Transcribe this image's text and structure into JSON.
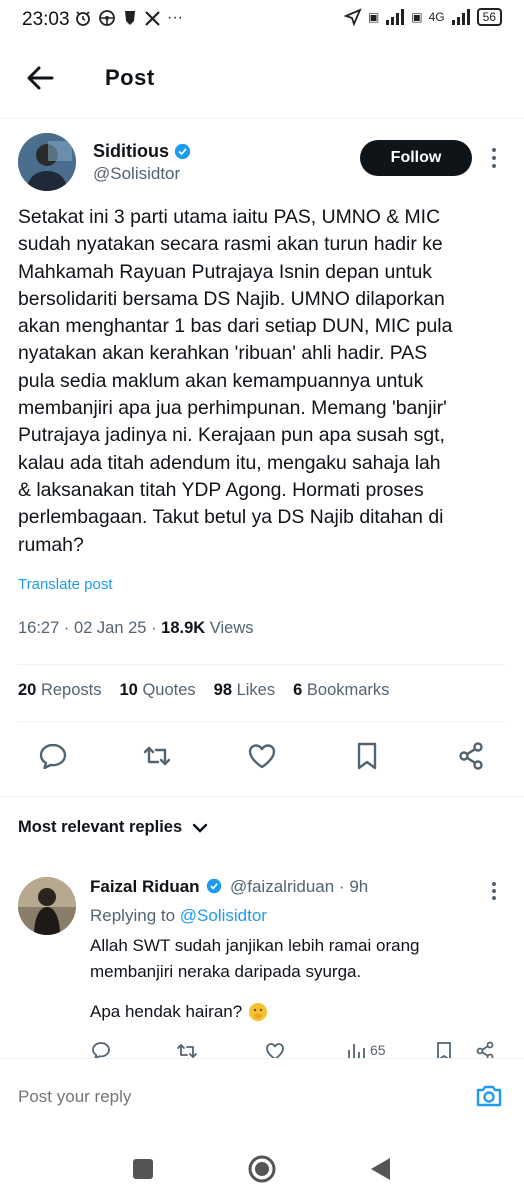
{
  "status_bar": {
    "time": "23:03",
    "network": "4G",
    "battery": "56"
  },
  "header": {
    "title": "Post"
  },
  "post": {
    "author_name": "Siditious",
    "author_handle": "@Solisidtor",
    "follow_label": "Follow",
    "text_lines": [
      "Setakat ini 3 parti utama iaitu PAS, UMNO & MIC",
      "sudah nyatakan secara rasmi akan turun hadir ke",
      "Mahkamah Rayuan Putrajaya Isnin depan untuk",
      "bersolidariti bersama DS Najib. UMNO dilaporkan",
      "akan menghantar 1 bas dari setiap DUN, MIC pula",
      "nyatakan akan kerahkan 'ribuan' ahli hadir. PAS",
      "pula sedia maklum akan kemampuannya untuk",
      "membanjiri apa jua perhimpunan. Memang 'banjir'",
      "Putrajaya jadinya ni. Kerajaan pun apa susah sgt,",
      "kalau ada titah adendum itu, mengaku sahaja lah",
      "& laksanakan titah YDP Agong. Hormati proses",
      "perlembagaan. Takut betul ya DS Najib ditahan di",
      "rumah?"
    ],
    "translate_label": "Translate post",
    "time": "16:27",
    "date": "02 Jan 25",
    "views_count": "18.9K",
    "views_label": "Views",
    "stats": {
      "reposts_count": "20",
      "reposts_label": "Reposts",
      "quotes_count": "10",
      "quotes_label": "Quotes",
      "likes_count": "98",
      "likes_label": "Likes",
      "bookmarks_count": "6",
      "bookmarks_label": "Bookmarks"
    }
  },
  "replies": {
    "sort_label": "Most relevant replies",
    "items": [
      {
        "name": "Faizal Riduan",
        "handle": "@faizalriduan",
        "age": "9h",
        "replying_prefix": "Replying to",
        "replying_to": "@Solisidtor",
        "text_lines": [
          "Allah SWT sudah janjikan lebih ramai orang",
          "membanjiri neraka daripada syurga."
        ],
        "text2": "Apa hendak hairan?",
        "views": "65"
      }
    ]
  },
  "compose": {
    "placeholder": "Post your reply"
  },
  "colors": {
    "accent": "#1d9bf0",
    "text": "#0f1419",
    "muted": "#536471",
    "divider": "#eff3f4"
  }
}
